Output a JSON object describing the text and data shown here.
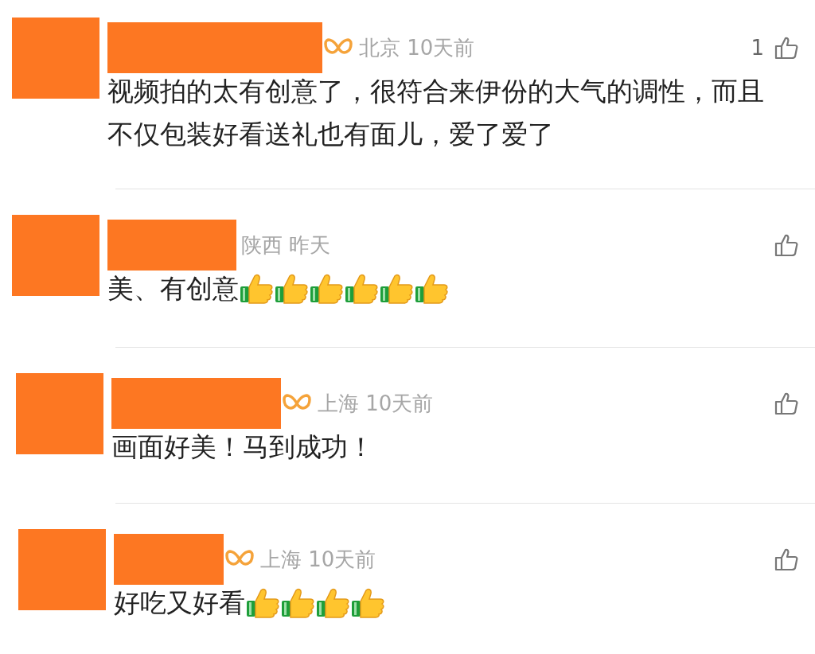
{
  "comments": [
    {
      "badge": true,
      "location": "北京",
      "time": "10天前",
      "likes": "1",
      "text": "视频拍的太有创意了，很符合来伊份的大气的调性，而且不仅包装好看送礼也有面儿，爱了爱了"
    },
    {
      "badge": false,
      "location": "陕西",
      "time": "昨天",
      "text": "美、有创意",
      "emojis": [
        {
          "kind": "thumbs-up"
        },
        {
          "kind": "thumbs-up"
        },
        {
          "kind": "thumbs-up"
        },
        {
          "kind": "thumbs-up"
        },
        {
          "kind": "thumbs-up"
        },
        {
          "kind": "thumbs-up"
        }
      ]
    },
    {
      "badge": true,
      "location": "上海",
      "time": "10天前",
      "text": "画面好美！马到成功！"
    },
    {
      "badge": true,
      "location": "上海",
      "time": "10天前",
      "text": "好吃又好看",
      "emojis": [
        {
          "kind": "thumbs-up"
        },
        {
          "kind": "thumbs-up"
        },
        {
          "kind": "thumbs-up"
        },
        {
          "kind": "thumbs-up"
        }
      ]
    }
  ]
}
